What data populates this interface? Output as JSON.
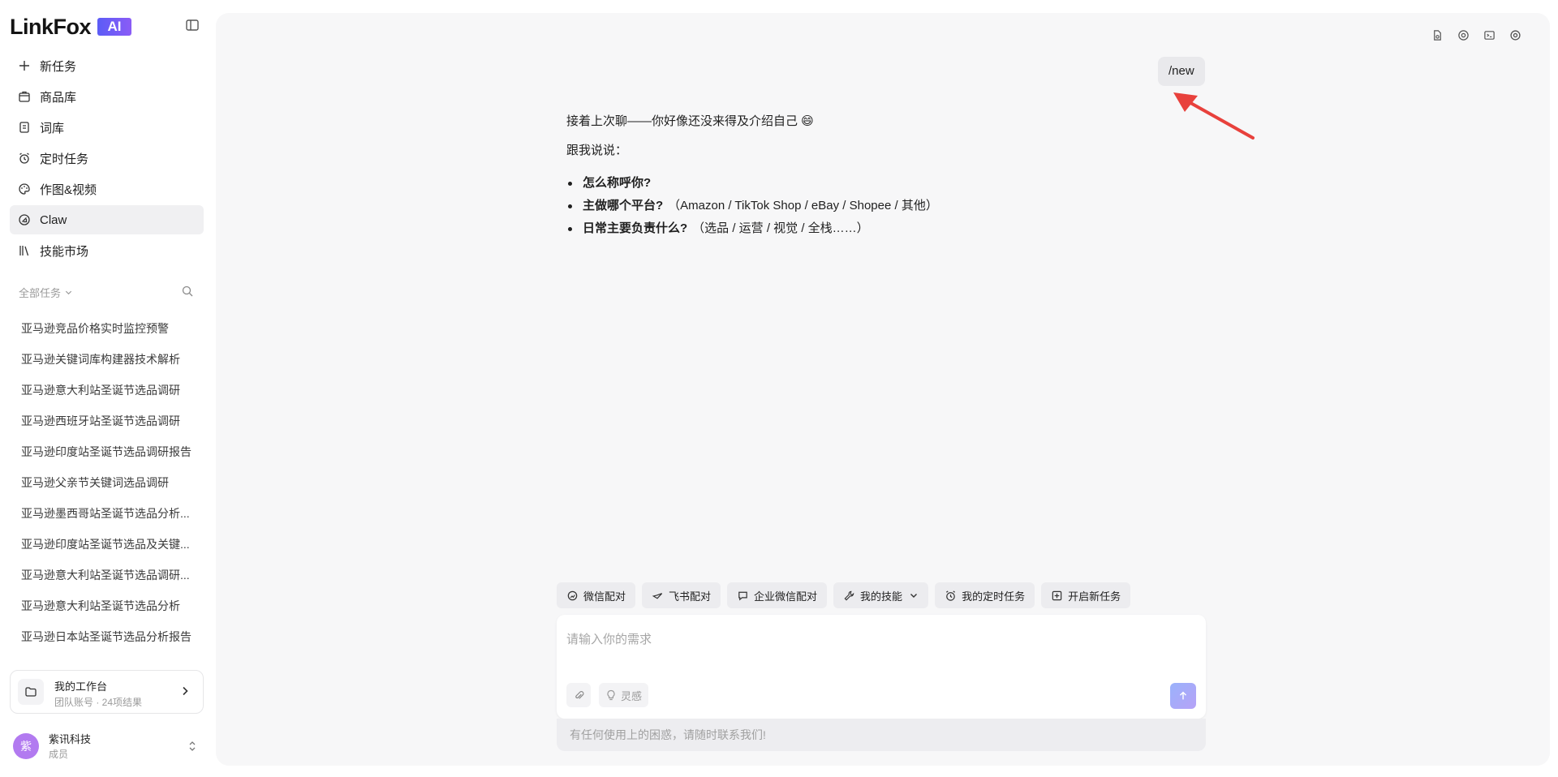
{
  "app": {
    "logo_text": "LinkFox",
    "logo_badge": "AI"
  },
  "sidebar": {
    "nav": [
      {
        "label": "新任务",
        "icon": "plus-icon"
      },
      {
        "label": "商品库",
        "icon": "bag-icon"
      },
      {
        "label": "词库",
        "icon": "book-icon"
      },
      {
        "label": "定时任务",
        "icon": "alarm-clock-icon"
      },
      {
        "label": "作图&视频",
        "icon": "palette-icon"
      },
      {
        "label": "Claw",
        "icon": "claw-icon",
        "active": true
      },
      {
        "label": "技能市场",
        "icon": "library-icon"
      }
    ],
    "tasks_filter": "全部任务",
    "tasks": [
      "亚马逊竞品价格实时监控预警",
      "亚马逊关键词库构建器技术解析",
      "亚马逊意大利站圣诞节选品调研",
      "亚马逊西班牙站圣诞节选品调研",
      "亚马逊印度站圣诞节选品调研报告",
      "亚马逊父亲节关键词选品调研",
      "亚马逊墨西哥站圣诞节选品分析...",
      "亚马逊印度站圣诞节选品及关键...",
      "亚马逊意大利站圣诞节选品调研...",
      "亚马逊意大利站圣诞节选品分析",
      "亚马逊日本站圣诞节选品分析报告"
    ],
    "workspace": {
      "title": "我的工作台",
      "subtitle": "团队账号 · 24项结果"
    },
    "user": {
      "avatar_char": "紫",
      "name": "紫讯科技",
      "role": "成员"
    }
  },
  "chat": {
    "user_message": "/new",
    "assistant": {
      "line1": "接着上次聊——你好像还没来得及介绍自己 😄",
      "line2": "跟我说说：",
      "bullets": [
        {
          "bold": "怎么称呼你?",
          "rest": ""
        },
        {
          "bold": "主做哪个平台?",
          "rest": "（Amazon / TikTok Shop / eBay / Shopee / 其他）"
        },
        {
          "bold": "日常主要负责什么?",
          "rest": "（选品 / 运营 / 视觉 / 全栈……）"
        }
      ]
    }
  },
  "quick_actions": [
    {
      "label": "微信配对",
      "icon": "wechat-icon"
    },
    {
      "label": "飞书配对",
      "icon": "feishu-icon"
    },
    {
      "label": "企业微信配对",
      "icon": "chat-bubble-icon"
    },
    {
      "label": "我的技能",
      "icon": "wrench-icon",
      "dropdown": true
    },
    {
      "label": "我的定时任务",
      "icon": "alarm-clock-icon"
    },
    {
      "label": "开启新任务",
      "icon": "plus-square-icon"
    }
  ],
  "composer": {
    "placeholder": "请输入你的需求",
    "inspiration_label": "灵感"
  },
  "footer_note": "有任何使用上的困惑，请随时联系我们!",
  "colors": {
    "accent_gradient_start": "#5b5cf6",
    "accent_gradient_end": "#8b5cf6",
    "annotation_arrow": "#e8413c",
    "avatar_bg": "#b27af0"
  }
}
